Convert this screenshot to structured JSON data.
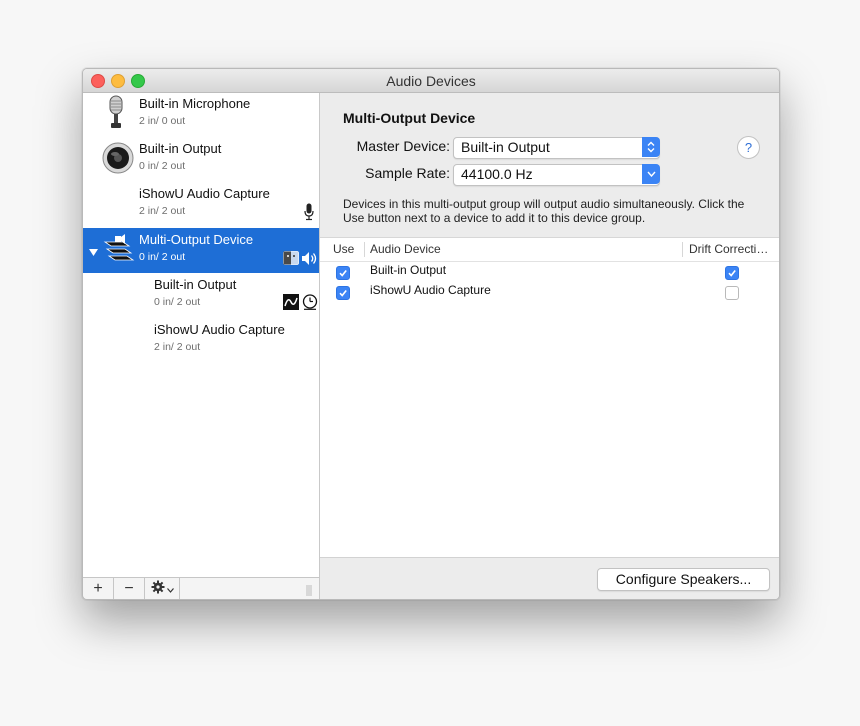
{
  "window": {
    "title": "Audio Devices"
  },
  "sidebar": {
    "devices": [
      {
        "name": "Built-in Microphone",
        "io": "2 in/ 0 out",
        "icon": "microphone-icon"
      },
      {
        "name": "Built-in Output",
        "io": "0 in/ 2 out",
        "icon": "speaker-icon"
      },
      {
        "name": "iShowU Audio Capture",
        "io": "2 in/ 2 out",
        "status_icon": "mic-small-icon"
      },
      {
        "name": "Multi-Output Device",
        "io": "0 in/ 2 out",
        "icon": "multi-output-icon",
        "selected": true
      },
      {
        "name": "Built-in Output",
        "io": "0 in/ 2 out",
        "sub": true
      },
      {
        "name": "iShowU Audio Capture",
        "io": "2 in/ 2 out",
        "sub": true
      }
    ],
    "footer": {
      "add": "+",
      "remove": "−"
    }
  },
  "main": {
    "title": "Multi-Output Device",
    "master_device_label": "Master Device:",
    "master_device_value": "Built-in Output",
    "sample_rate_label": "Sample Rate:",
    "sample_rate_value": "44100.0 Hz",
    "help": "?",
    "description": "Devices in this multi-output group will output audio simultaneously. Click the Use button next to a device to add it to this device group.",
    "table": {
      "columns": [
        "Use",
        "Audio Device",
        "Drift Correcti…"
      ],
      "rows": [
        {
          "use": true,
          "device": "Built-in Output",
          "drift": true
        },
        {
          "use": true,
          "device": "iShowU Audio Capture",
          "drift": false
        }
      ]
    },
    "configure_button": "Configure Speakers..."
  },
  "colors": {
    "selection": "#1e6ed6",
    "accent": "#3b84f5"
  }
}
